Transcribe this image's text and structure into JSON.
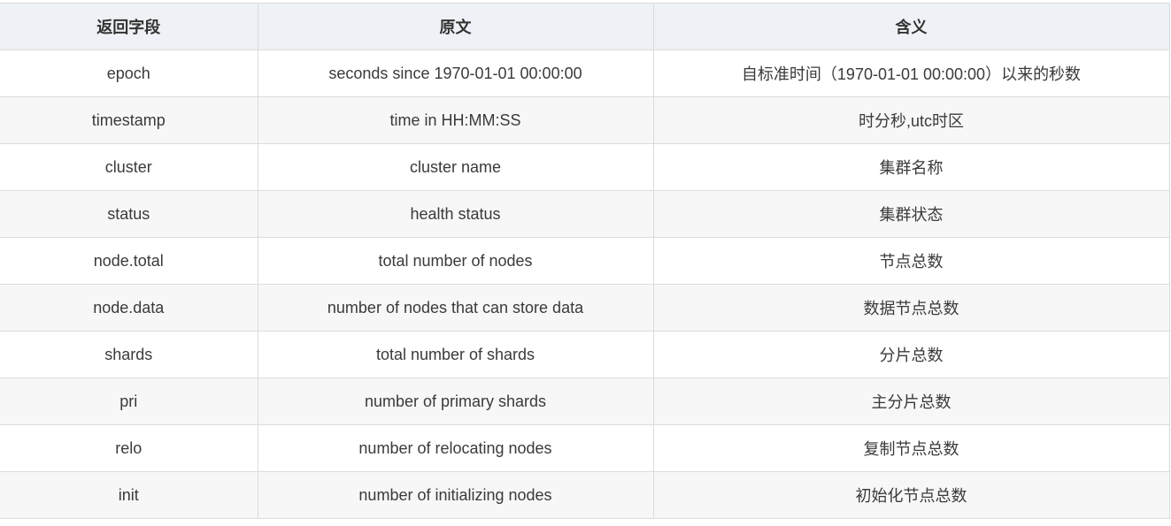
{
  "table": {
    "headers": [
      "返回字段",
      "原文",
      "含义"
    ],
    "rows": [
      [
        "epoch",
        "seconds since 1970-01-01 00:00:00",
        "自标准时间（1970-01-01 00:00:00）以来的秒数"
      ],
      [
        "timestamp",
        "time in HH:MM:SS",
        "时分秒,utc时区"
      ],
      [
        "cluster",
        "cluster name",
        "集群名称"
      ],
      [
        "status",
        "health status",
        "集群状态"
      ],
      [
        "node.total",
        "total number of nodes",
        "节点总数"
      ],
      [
        "node.data",
        "number of nodes that can store data",
        "数据节点总数"
      ],
      [
        "shards",
        "total number of shards",
        "分片总数"
      ],
      [
        "pri",
        "number of primary shards",
        "主分片总数"
      ],
      [
        "relo",
        "number of relocating nodes",
        "复制节点总数"
      ],
      [
        "init",
        "number of initializing nodes",
        "初始化节点总数"
      ]
    ]
  }
}
